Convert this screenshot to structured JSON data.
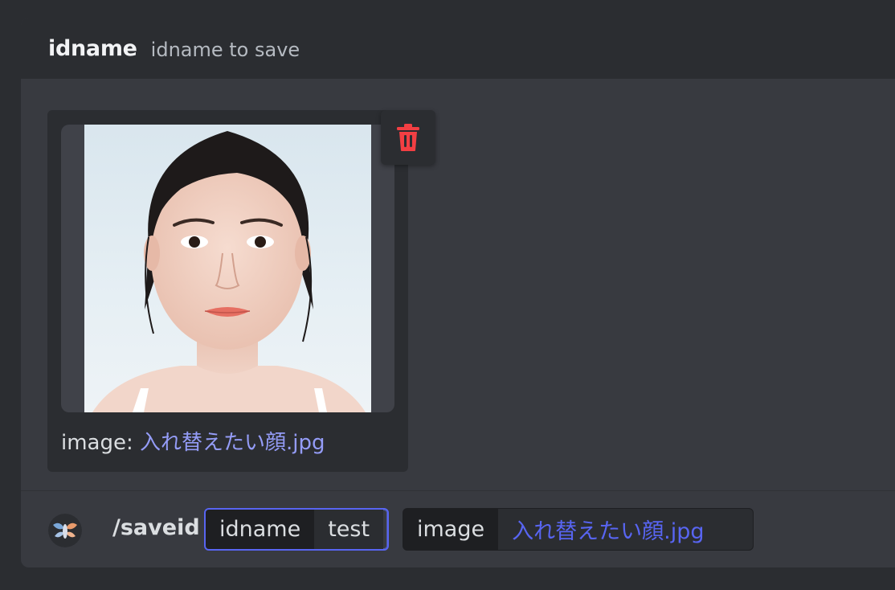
{
  "option": {
    "name": "idname",
    "description": "idname to save"
  },
  "attachment": {
    "caption_prefix": "image: ",
    "filename": "入れ替えたい顔.jpg",
    "delete_icon": "trash-icon",
    "delete_color": "#f23f43"
  },
  "command_bar": {
    "command": "/saveid",
    "avatar_icon": "bot-avatar",
    "params": [
      {
        "label": "idname",
        "value": "test"
      },
      {
        "label": "image",
        "value": "入れ替えたい顔.jpg"
      }
    ]
  },
  "colors": {
    "background": "#2b2d31",
    "panel": "#383a40",
    "accent": "#5865f2",
    "link": "#949cf7"
  }
}
